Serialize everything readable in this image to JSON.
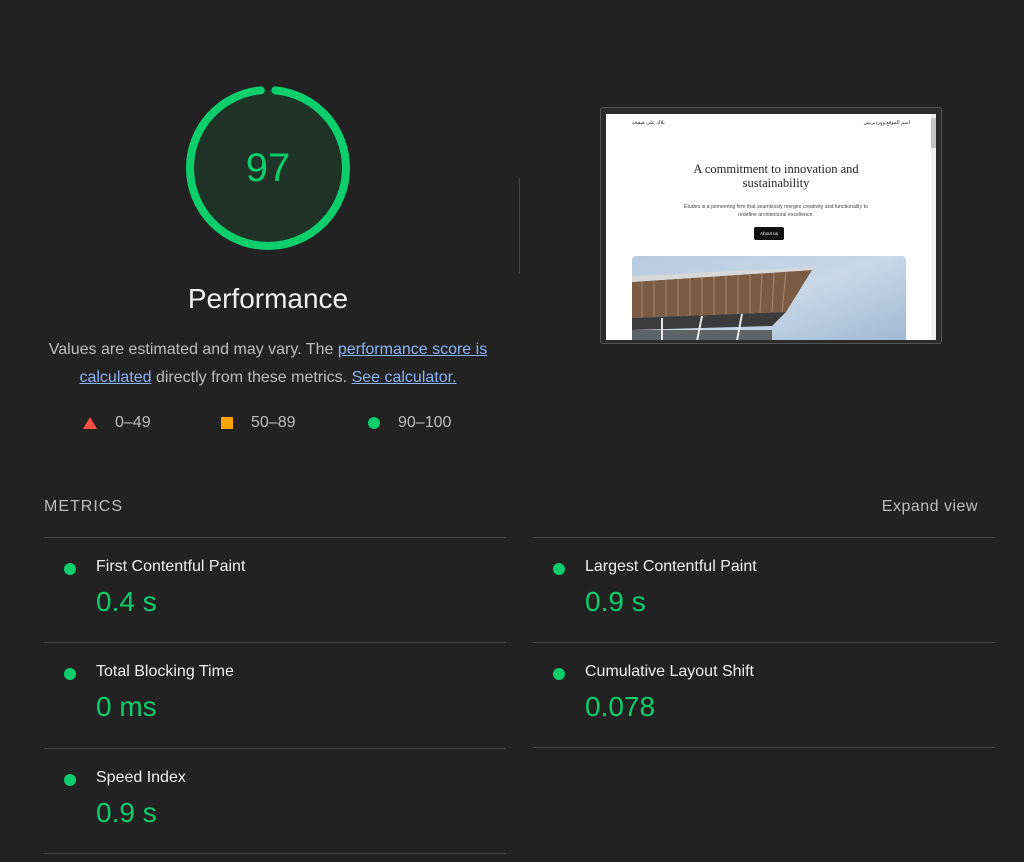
{
  "gauge": {
    "score": "97",
    "fraction": 0.97,
    "color": "#0cce6b"
  },
  "performance": {
    "title": "Performance",
    "desc_part1": "Values are estimated and may vary. The ",
    "link_score": "performance score is calculated",
    "desc_part2": " directly from these metrics. ",
    "link_calc": "See calculator."
  },
  "legend": [
    {
      "icon": "triangle-icon",
      "label": "0–49",
      "color": "#ff4e42"
    },
    {
      "icon": "square-icon",
      "label": "50–89",
      "color": "#ffa400"
    },
    {
      "icon": "circle-icon",
      "label": "90–100",
      "color": "#0cce6b"
    }
  ],
  "screenshot": {
    "nav_left": "بلاك على صفحة",
    "nav_right": "اسم الموقع ووردبريس",
    "heading": "A commitment to innovation and sustainability",
    "subtext": "Études is a pioneering firm that seamlessly merges creativity and functionality to redefine architectural excellence.",
    "button": "About us"
  },
  "metrics_section": {
    "title": "METRICS",
    "expand": "Expand view"
  },
  "metrics": [
    {
      "label": "First Contentful Paint",
      "value": "0.4 s",
      "status_color": "#0cce6b"
    },
    {
      "label": "Largest Contentful Paint",
      "value": "0.9 s",
      "status_color": "#0cce6b"
    },
    {
      "label": "Total Blocking Time",
      "value": "0 ms",
      "status_color": "#0cce6b"
    },
    {
      "label": "Cumulative Layout Shift",
      "value": "0.078",
      "status_color": "#0cce6b"
    },
    {
      "label": "Speed Index",
      "value": "0.9 s",
      "status_color": "#0cce6b"
    }
  ]
}
